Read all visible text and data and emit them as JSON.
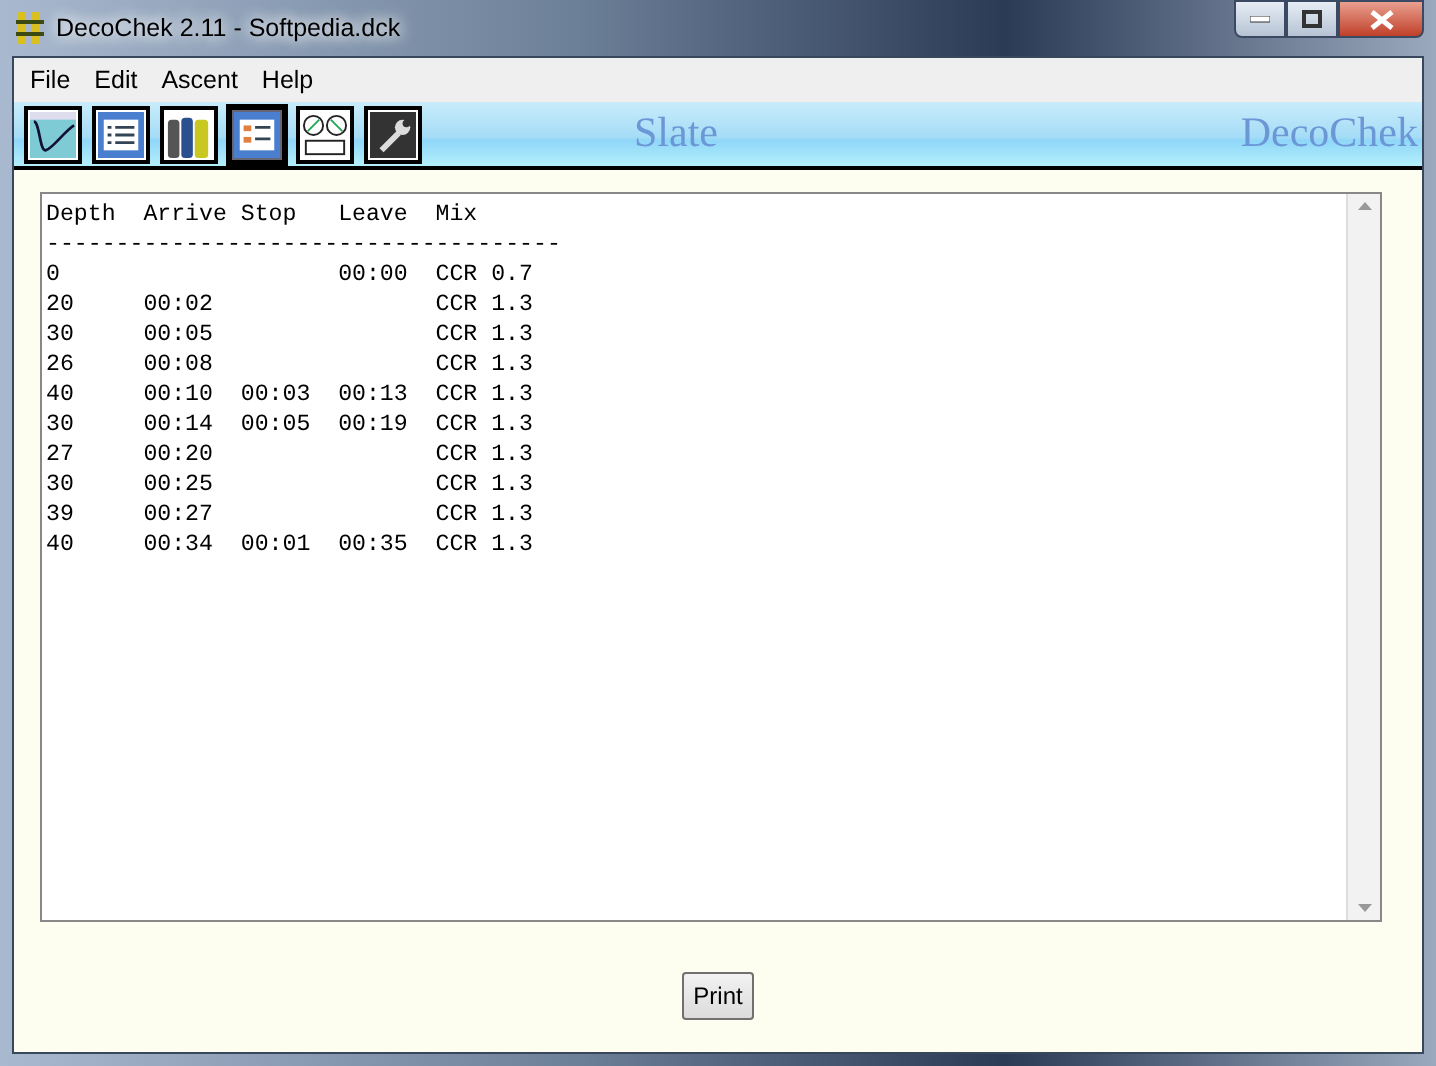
{
  "window": {
    "title": "DecoChek 2.11 - Softpedia.dck"
  },
  "menu": [
    "File",
    "Edit",
    "Ascent",
    "Help"
  ],
  "toolbar": [
    {
      "kind": "profile",
      "selected": false
    },
    {
      "kind": "list",
      "selected": false
    },
    {
      "kind": "cylinders",
      "selected": false
    },
    {
      "kind": "plan",
      "selected": true
    },
    {
      "kind": "settings",
      "selected": false
    },
    {
      "kind": "tools",
      "selected": false
    }
  ],
  "banner": {
    "view": "Slate",
    "brand": "DecoChek"
  },
  "plan": {
    "columns": [
      "Depth",
      "Arrive",
      "Stop",
      "Leave",
      "Mix"
    ],
    "rule": "-------------------------------------",
    "rows": [
      [
        "0",
        "",
        "",
        "00:00",
        "CCR 0.7"
      ],
      [
        "20",
        "00:02",
        "",
        "",
        "CCR 1.3"
      ],
      [
        "30",
        "00:05",
        "",
        "",
        "CCR 1.3"
      ],
      [
        "26",
        "00:08",
        "",
        "",
        "CCR 1.3"
      ],
      [
        "40",
        "00:10",
        "00:03",
        "00:13",
        "CCR 1.3"
      ],
      [
        "30",
        "00:14",
        "00:05",
        "00:19",
        "CCR 1.3"
      ],
      [
        "27",
        "00:20",
        "",
        "",
        "CCR 1.3"
      ],
      [
        "30",
        "00:25",
        "",
        "",
        "CCR 1.3"
      ],
      [
        "39",
        "00:27",
        "",
        "",
        "CCR 1.3"
      ],
      [
        "40",
        "00:34",
        "00:01",
        "00:35",
        "CCR 1.3"
      ]
    ]
  },
  "buttons": [
    "Print"
  ]
}
